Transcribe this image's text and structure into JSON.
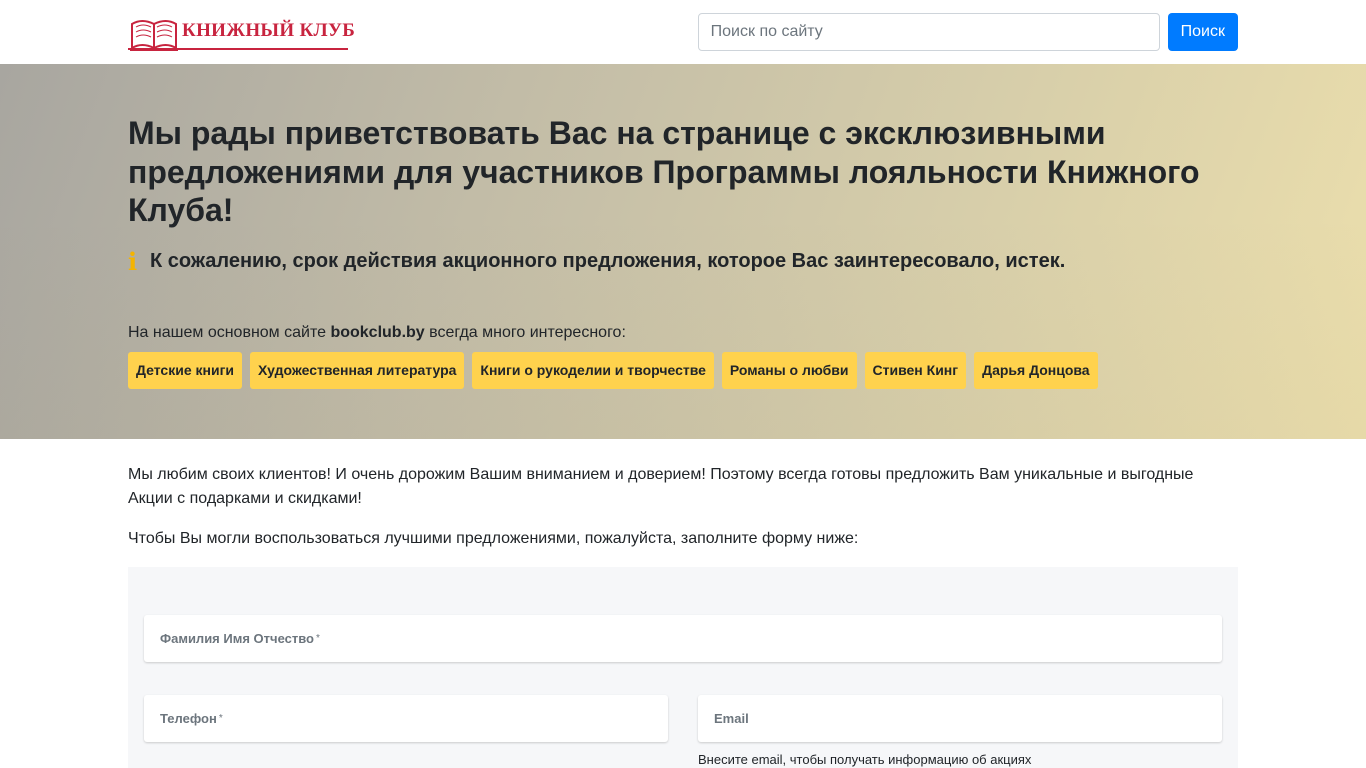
{
  "header": {
    "logo_text": "КНИЖНЫЙ КЛУБ",
    "search_placeholder": "Поиск по сайту",
    "search_button": "Поиск"
  },
  "hero": {
    "title": "Мы рады приветствовать Вас на странице с эксклюзивными предложениями для участников Программы лояльности Книжного Клуба!",
    "notice": "К сожалению, срок действия акционного предложения, которое Вас заинтересовало, истек.",
    "intro_before": "На нашем основном сайте ",
    "intro_site": "bookclub.by",
    "intro_after": " всегда много интересного:",
    "categories": [
      "Детские книги",
      "Художественная литература",
      "Книги о рукоделии и творчестве",
      "Романы о любви",
      "Стивен Кинг",
      "Дарья Донцова"
    ]
  },
  "content": {
    "paragraph1": "Мы любим своих клиентов! И очень дорожим Вашим вниманием и доверием! Поэтому всегда готовы предложить Вам уникальные и выгодные Акции с подарками и скидками!",
    "paragraph2": "Чтобы Вы могли воспользоваться лучшими предложениями, пожалуйста, заполните форму ниже:"
  },
  "form": {
    "fio_label": "Фамилия Имя Отчество",
    "phone_label": "Телефон",
    "email_label": "Email",
    "required_mark": "*",
    "email_help": "Внесите email, чтобы получать информацию об акциях"
  },
  "colors": {
    "brand_red": "#c8243f",
    "primary_blue": "#007bff",
    "chip_yellow": "#ffd24d",
    "info_icon": "#f4b400"
  },
  "icons": {
    "logo": "open-book-icon",
    "notice": "info-icon"
  }
}
